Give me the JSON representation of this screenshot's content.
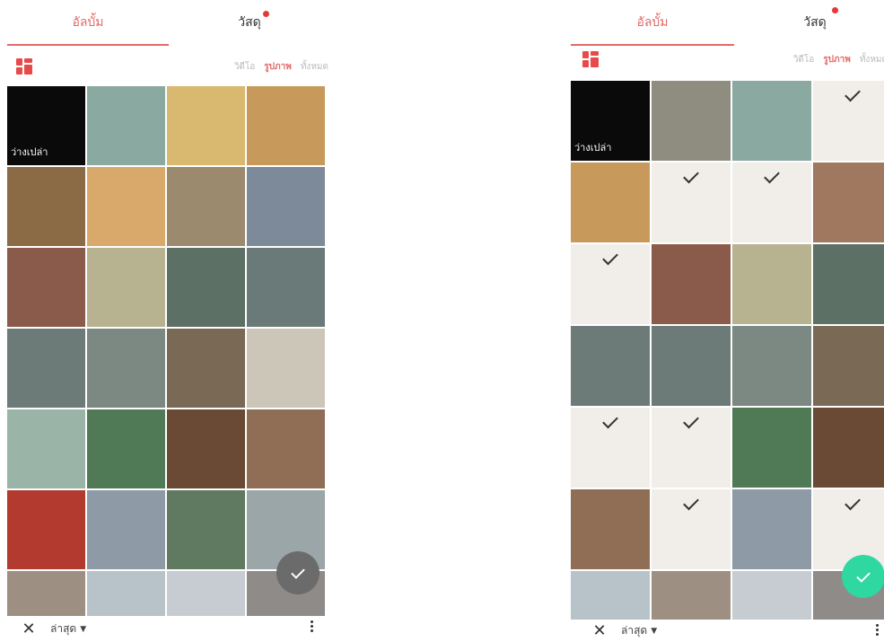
{
  "left": {
    "tabs": {
      "album": "อัลบั้ม",
      "temple": "วัสดุ"
    },
    "filters": {
      "video": "วิดีโอ",
      "photo": "รูปภาพ",
      "all": "ทั้งหมด"
    },
    "empty_label": "ว่างเปล่า",
    "sort": {
      "label": "ล่าสุด"
    },
    "fab_color": "#6b6b6b",
    "cells": [
      "#0a0a0a",
      "#8aa9a0",
      "#d9b870",
      "#c79a5c",
      "#8a6b45",
      "#d8a96a",
      "#9c8a6f",
      "#7d8a9a",
      "#8a5a4a",
      "#b7b390",
      "#5d7066",
      "#6a7a78",
      "#6c7b78",
      "#7c8882",
      "#7a6a55",
      "#cbc6b8",
      "#9ab4a8",
      "#4f7a55",
      "#6a4a35",
      "#8f6e55",
      "#b23a2e",
      "#8e9aa5",
      "#5f7a60",
      "#9aa6a8",
      "#9d8f82",
      "#b7c3c8",
      "#c6ccd2",
      "#8e8b88"
    ]
  },
  "right": {
    "tabs": {
      "album": "อัลบั้ม",
      "temple": "วัสดุ"
    },
    "filters": {
      "video": "วิดีโอ",
      "photo": "รูปภาพ",
      "all": "ทั้งหมด"
    },
    "empty_label": "ว่างเปล่า",
    "sort": {
      "label": "ล่าสุด"
    },
    "fab_color": "#2ed8a0",
    "cells": [
      "#0a0a0a",
      "#8e8d7f",
      "#8aa9a0",
      "#f1eeea",
      "#c79a5c",
      "#f1eeea",
      "#f1eeea",
      "#a07860",
      "#f1eeea",
      "#8a5a4a",
      "#b7b390",
      "#5d7066",
      "#6c7b78",
      "#6c7b78",
      "#7c8882",
      "#7a6a55",
      "#f1eeea",
      "#f1eeea",
      "#4f7a55",
      "#6a4a35",
      "#8f6e55",
      "#f1eeea",
      "#8e9aa5",
      "#f1eeea",
      "#b7c3c8",
      "#9d8f82",
      "#c6ccd2",
      "#8e8b88"
    ],
    "checked": [
      3,
      5,
      6,
      8,
      16,
      17,
      21,
      23
    ]
  }
}
